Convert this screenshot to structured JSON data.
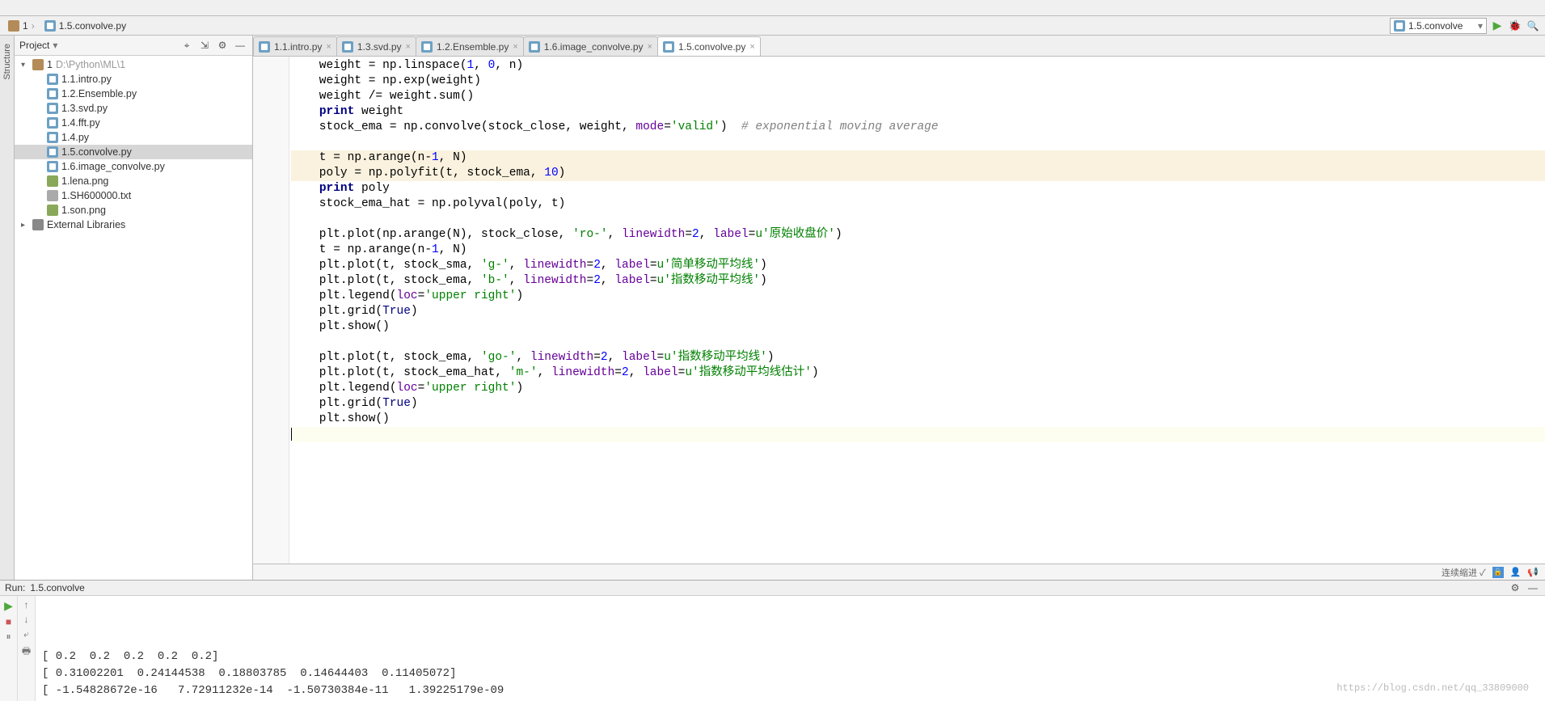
{
  "nav": {
    "crumbs": [
      "1",
      "1.5.convolve.py"
    ],
    "run_target": "1.5.convolve"
  },
  "project_panel": {
    "title": "Project",
    "tree": [
      {
        "level": 0,
        "type": "folder",
        "label": "1",
        "hint": " D:\\Python\\ML\\1",
        "expanded": true,
        "sel": false
      },
      {
        "level": 1,
        "type": "py",
        "label": "1.1.intro.py",
        "sel": false
      },
      {
        "level": 1,
        "type": "py",
        "label": "1.2.Ensemble.py",
        "sel": false
      },
      {
        "level": 1,
        "type": "py",
        "label": "1.3.svd.py",
        "sel": false
      },
      {
        "level": 1,
        "type": "py",
        "label": "1.4.fft.py",
        "sel": false
      },
      {
        "level": 1,
        "type": "py",
        "label": "1.4.py",
        "sel": false
      },
      {
        "level": 1,
        "type": "py",
        "label": "1.5.convolve.py",
        "sel": true
      },
      {
        "level": 1,
        "type": "py",
        "label": "1.6.image_convolve.py",
        "sel": false
      },
      {
        "level": 1,
        "type": "img",
        "label": "1.lena.png",
        "sel": false
      },
      {
        "level": 1,
        "type": "txt",
        "label": "1.SH600000.txt",
        "sel": false
      },
      {
        "level": 1,
        "type": "img",
        "label": "1.son.png",
        "sel": false
      },
      {
        "level": 0,
        "type": "lib",
        "label": "External Libraries",
        "expanded": false,
        "sel": false
      }
    ]
  },
  "tabs": [
    {
      "label": "1.1.intro.py",
      "active": false
    },
    {
      "label": "1.3.svd.py",
      "active": false
    },
    {
      "label": "1.2.Ensemble.py",
      "active": false
    },
    {
      "label": "1.6.image_convolve.py",
      "active": false
    },
    {
      "label": "1.5.convolve.py",
      "active": true
    }
  ],
  "code": {
    "lines": [
      {
        "indent": "    ",
        "segs": [
          {
            "t": "weight = np.linspace(",
            "c": ""
          },
          {
            "t": "1",
            "c": "num"
          },
          {
            "t": ", ",
            "c": ""
          },
          {
            "t": "0",
            "c": "num"
          },
          {
            "t": ", n)",
            "c": ""
          }
        ]
      },
      {
        "indent": "    ",
        "segs": [
          {
            "t": "weight = np.exp(weight)",
            "c": ""
          }
        ]
      },
      {
        "indent": "    ",
        "segs": [
          {
            "t": "weight /= weight.sum()",
            "c": ""
          }
        ]
      },
      {
        "indent": "    ",
        "segs": [
          {
            "t": "print",
            "c": "kw"
          },
          {
            "t": " weight",
            "c": ""
          }
        ]
      },
      {
        "indent": "    ",
        "segs": [
          {
            "t": "stock_ema = np.convolve(stock_close, weight, ",
            "c": ""
          },
          {
            "t": "mode",
            "c": "arg"
          },
          {
            "t": "=",
            "c": ""
          },
          {
            "t": "'valid'",
            "c": "str"
          },
          {
            "t": ")  ",
            "c": ""
          },
          {
            "t": "# exponential moving average",
            "c": "com"
          }
        ]
      },
      {
        "indent": "",
        "segs": []
      },
      {
        "indent": "    ",
        "hl": true,
        "segs": [
          {
            "t": "t = np.arange(n-",
            "c": ""
          },
          {
            "t": "1",
            "c": "num"
          },
          {
            "t": ", N)",
            "c": ""
          }
        ]
      },
      {
        "indent": "    ",
        "hl": true,
        "segs": [
          {
            "t": "poly = np.polyfit(t, stock_ema, ",
            "c": ""
          },
          {
            "t": "10",
            "c": "num"
          },
          {
            "t": ")",
            "c": ""
          }
        ]
      },
      {
        "indent": "    ",
        "segs": [
          {
            "t": "print",
            "c": "kw"
          },
          {
            "t": " poly",
            "c": ""
          }
        ]
      },
      {
        "indent": "    ",
        "segs": [
          {
            "t": "stock_ema_hat = np.polyval(poly, t)",
            "c": ""
          }
        ]
      },
      {
        "indent": "",
        "segs": []
      },
      {
        "indent": "    ",
        "segs": [
          {
            "t": "plt.plot(np.arange(N), stock_close, ",
            "c": ""
          },
          {
            "t": "'ro-'",
            "c": "str"
          },
          {
            "t": ", ",
            "c": ""
          },
          {
            "t": "linewidth",
            "c": "arg"
          },
          {
            "t": "=",
            "c": ""
          },
          {
            "t": "2",
            "c": "num"
          },
          {
            "t": ", ",
            "c": ""
          },
          {
            "t": "label",
            "c": "arg"
          },
          {
            "t": "=",
            "c": ""
          },
          {
            "t": "u'原始收盘价'",
            "c": "str"
          },
          {
            "t": ")",
            "c": ""
          }
        ]
      },
      {
        "indent": "    ",
        "segs": [
          {
            "t": "t = np.arange(n-",
            "c": ""
          },
          {
            "t": "1",
            "c": "num"
          },
          {
            "t": ", N)",
            "c": ""
          }
        ]
      },
      {
        "indent": "    ",
        "segs": [
          {
            "t": "plt.plot(t, stock_sma, ",
            "c": ""
          },
          {
            "t": "'g-'",
            "c": "str"
          },
          {
            "t": ", ",
            "c": ""
          },
          {
            "t": "linewidth",
            "c": "arg"
          },
          {
            "t": "=",
            "c": ""
          },
          {
            "t": "2",
            "c": "num"
          },
          {
            "t": ", ",
            "c": ""
          },
          {
            "t": "label",
            "c": "arg"
          },
          {
            "t": "=",
            "c": ""
          },
          {
            "t": "u'简单移动平均线'",
            "c": "str"
          },
          {
            "t": ")",
            "c": ""
          }
        ]
      },
      {
        "indent": "    ",
        "segs": [
          {
            "t": "plt.plot(t, stock_ema, ",
            "c": ""
          },
          {
            "t": "'b-'",
            "c": "str"
          },
          {
            "t": ", ",
            "c": ""
          },
          {
            "t": "linewidth",
            "c": "arg"
          },
          {
            "t": "=",
            "c": ""
          },
          {
            "t": "2",
            "c": "num"
          },
          {
            "t": ", ",
            "c": ""
          },
          {
            "t": "label",
            "c": "arg"
          },
          {
            "t": "=",
            "c": ""
          },
          {
            "t": "u'指数移动平均线'",
            "c": "str"
          },
          {
            "t": ")",
            "c": ""
          }
        ]
      },
      {
        "indent": "    ",
        "segs": [
          {
            "t": "plt.legend(",
            "c": ""
          },
          {
            "t": "loc",
            "c": "arg"
          },
          {
            "t": "=",
            "c": ""
          },
          {
            "t": "'upper right'",
            "c": "str"
          },
          {
            "t": ")",
            "c": ""
          }
        ]
      },
      {
        "indent": "    ",
        "segs": [
          {
            "t": "plt.grid(",
            "c": ""
          },
          {
            "t": "True",
            "c": "lit"
          },
          {
            "t": ")",
            "c": ""
          }
        ]
      },
      {
        "indent": "    ",
        "segs": [
          {
            "t": "plt.show()",
            "c": ""
          }
        ]
      },
      {
        "indent": "",
        "segs": []
      },
      {
        "indent": "    ",
        "segs": [
          {
            "t": "plt.plot(t, stock_ema, ",
            "c": ""
          },
          {
            "t": "'go-'",
            "c": "str"
          },
          {
            "t": ", ",
            "c": ""
          },
          {
            "t": "linewidth",
            "c": "arg"
          },
          {
            "t": "=",
            "c": ""
          },
          {
            "t": "2",
            "c": "num"
          },
          {
            "t": ", ",
            "c": ""
          },
          {
            "t": "label",
            "c": "arg"
          },
          {
            "t": "=",
            "c": ""
          },
          {
            "t": "u'指数移动平均线'",
            "c": "str"
          },
          {
            "t": ")",
            "c": ""
          }
        ]
      },
      {
        "indent": "    ",
        "segs": [
          {
            "t": "plt.plot(t, stock_ema_hat, ",
            "c": ""
          },
          {
            "t": "'m-'",
            "c": "str"
          },
          {
            "t": ", ",
            "c": ""
          },
          {
            "t": "linewidth",
            "c": "arg"
          },
          {
            "t": "=",
            "c": ""
          },
          {
            "t": "2",
            "c": "num"
          },
          {
            "t": ", ",
            "c": ""
          },
          {
            "t": "label",
            "c": "arg"
          },
          {
            "t": "=",
            "c": ""
          },
          {
            "t": "u'指数移动平均线估计'",
            "c": "str"
          },
          {
            "t": ")",
            "c": ""
          }
        ]
      },
      {
        "indent": "    ",
        "segs": [
          {
            "t": "plt.legend(",
            "c": ""
          },
          {
            "t": "loc",
            "c": "arg"
          },
          {
            "t": "=",
            "c": ""
          },
          {
            "t": "'upper right'",
            "c": "str"
          },
          {
            "t": ")",
            "c": ""
          }
        ]
      },
      {
        "indent": "    ",
        "segs": [
          {
            "t": "plt.grid(",
            "c": ""
          },
          {
            "t": "True",
            "c": "lit"
          },
          {
            "t": ")",
            "c": ""
          }
        ]
      },
      {
        "indent": "    ",
        "segs": [
          {
            "t": "plt.show()",
            "c": ""
          }
        ]
      }
    ]
  },
  "status": {
    "info": "连续缩进 ✓"
  },
  "run_panel": {
    "title": "Run:",
    "target": "1.5.convolve",
    "output": [
      "[ 0.2  0.2  0.2  0.2  0.2]",
      "[ 0.31002201  0.24144538  0.18803785  0.14644403  0.11405072]",
      "[ -1.54828672e-16   7.72911232e-14  -1.50730384e-11   1.39225179e-09"
    ]
  },
  "watermark": "https://blog.csdn.net/qq_33809000"
}
